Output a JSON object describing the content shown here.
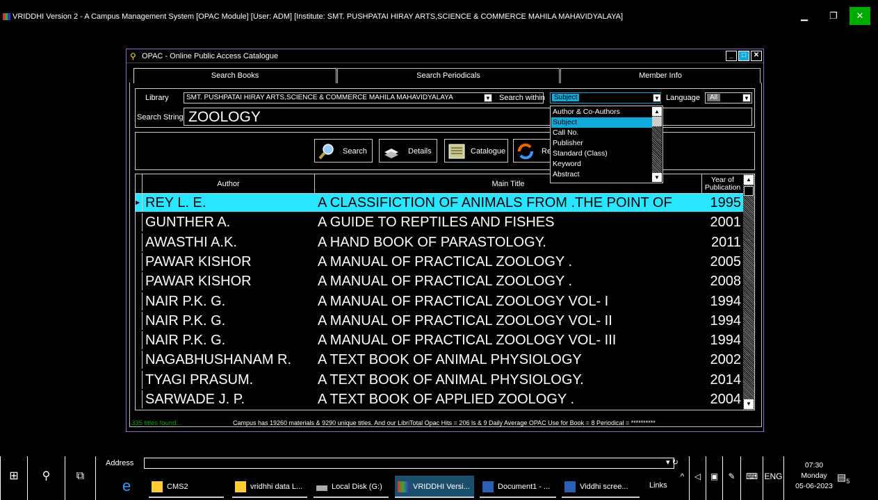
{
  "app": {
    "title": "VRIDDHI Version 2 - A Campus Management System [OPAC Module] [User: ADM] [Institute: SMT. PUSHPATAI HIRAY ARTS,SCIENCE & COMMERCE MAHILA MAHAVIDYALAYA]",
    "min_glyph": "▁",
    "max_glyph": "❐",
    "close_glyph": "✕"
  },
  "opac": {
    "title": "OPAC - Online Public Access Catalogue",
    "tabs": [
      "Search Books",
      "Search Periodicals",
      "Member Info"
    ],
    "library_label": "Library",
    "library_value": "SMT. PUSHPATAI HIRAY ARTS,SCIENCE & COMMERCE MAHILA MAHAVIDYALAYA",
    "search_within_label": "Search within",
    "search_within_value": "Subject",
    "search_within_options": [
      "Author & Co-Authors",
      "Subject",
      "Call No.",
      "Publisher",
      "Standard (Class)",
      "Keyword",
      "Abstract"
    ],
    "language_label": "Language",
    "language_value": "All",
    "search_string_label": "Search String",
    "search_string_value": "ZOOLOGY",
    "buttons": {
      "search": "Search",
      "details": "Details",
      "catalogue": "Catalogue",
      "refresh": "Re"
    },
    "grid": {
      "headers": {
        "author": "Author",
        "title": "Main Title",
        "year": "Year of Publication"
      },
      "rows": [
        {
          "author": "REY L. E.",
          "title": "A CLASSIFICTION OF ANIMALS FROM .THE POINT OF",
          "year": "1995"
        },
        {
          "author": "GUNTHER A.",
          "title": "A GUIDE TO REPTILES AND FISHES",
          "year": "2001"
        },
        {
          "author": "AWASTHI A.K.",
          "title": "A HAND BOOK OF PARASTOLOGY.",
          "year": "2011"
        },
        {
          "author": "PAWAR KISHOR",
          "title": "A MANUAL OF PRACTICAL ZOOLOGY .",
          "year": "2005"
        },
        {
          "author": "PAWAR KISHOR",
          "title": "A MANUAL OF PRACTICAL ZOOLOGY .",
          "year": "2008"
        },
        {
          "author": "NAIR P.K. G.",
          "title": "A MANUAL OF PRACTICAL ZOOLOGY VOL- I",
          "year": "1994"
        },
        {
          "author": "NAIR P.K. G.",
          "title": "A MANUAL OF PRACTICAL ZOOLOGY VOL- II",
          "year": "1994"
        },
        {
          "author": "NAIR P.K. G.",
          "title": "A MANUAL OF PRACTICAL ZOOLOGY VOL- III",
          "year": "1994"
        },
        {
          "author": "NAGABHUSHANAM R.",
          "title": "A TEXT BOOK OF ANIMAL PHYSIOLOGY",
          "year": "2002"
        },
        {
          "author": "TYAGI PRASUM.",
          "title": "A TEXT BOOK OF ANIMAL PHYSIOLOGY.",
          "year": "2014"
        },
        {
          "author": "SARWADE J. P.",
          "title": "A TEXT BOOK OF APPLIED ZOOLOGY .",
          "year": "2004"
        }
      ]
    },
    "status_count": "335 titles found...",
    "status_info": "Campus has 19260 materials & 9290 unique titles. And our LibriTotal Opac Hits = 206 ls & 9 Daily Average OPAC Use for Book = 8 Periodical = **********"
  },
  "taskbar": {
    "address_label": "Address",
    "items": [
      "CMS2",
      "vridhhi data L...",
      "Local Disk (G:)",
      "VRIDDHI Versi...",
      "Document1 - ...",
      "Viddhi scree..."
    ],
    "links_label": "Links",
    "lang": "ENG",
    "time": "07:30",
    "day": "Monday",
    "date": "05-06-2023",
    "notifications": "5"
  },
  "colors": {
    "accent": "#1ad",
    "selected_row": "#28e6ff",
    "status_green": "#0a0"
  }
}
